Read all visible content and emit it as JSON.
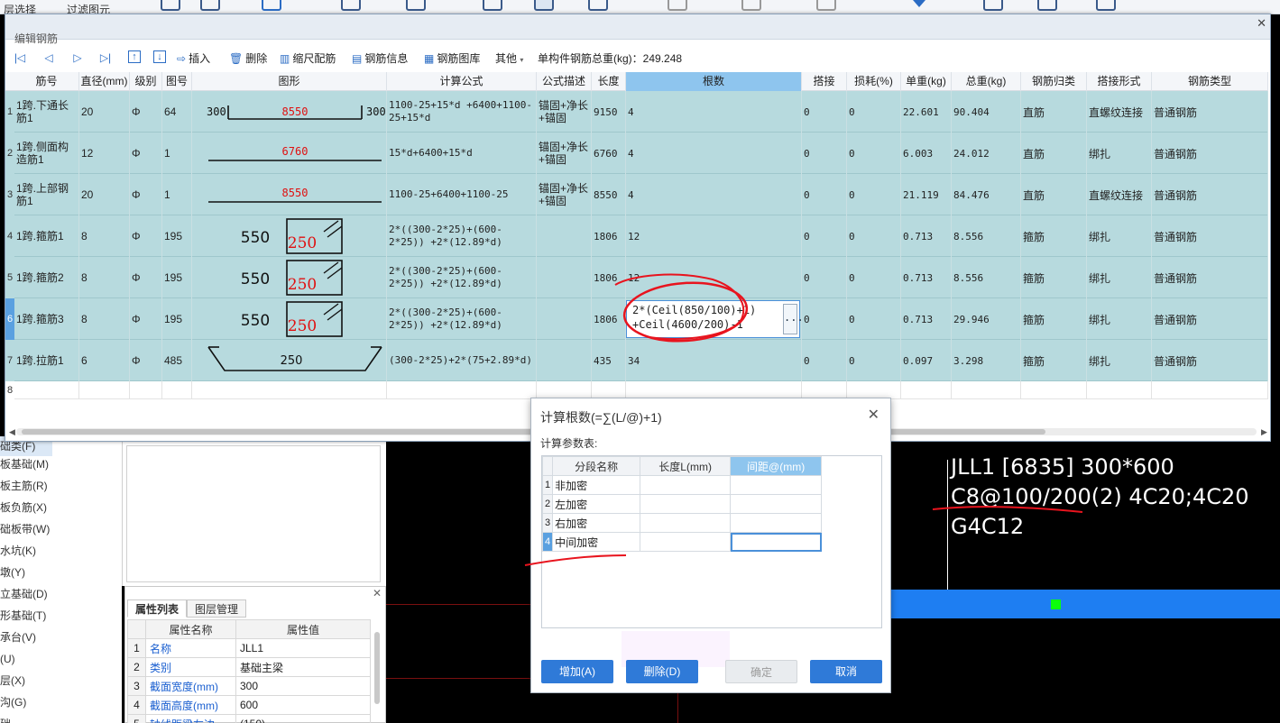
{
  "app_toolbar": {
    "left_text": "层选择",
    "filter_text": "过滤图元"
  },
  "left_tree": {
    "items": [
      "础类(F)",
      "板基础(M)",
      "板主筋(R)",
      "板负筋(X)",
      "础板带(W)",
      "水坑(K)",
      "墩(Y)",
      "立基础(D)",
      "形基础(T)",
      "承台(V)",
      "(U)",
      "层(X)",
      "沟(G)",
      "础"
    ]
  },
  "property_panel": {
    "close": "✕",
    "tabs": [
      "属性列表",
      "图层管理"
    ],
    "headers": [
      "属性名称",
      "属性值"
    ],
    "rows": [
      {
        "idx": "1",
        "name": "名称",
        "value": "JLL1"
      },
      {
        "idx": "2",
        "name": "类别",
        "value": "基础主梁"
      },
      {
        "idx": "3",
        "name": "截面宽度(mm)",
        "value": "300"
      },
      {
        "idx": "4",
        "name": "截面高度(mm)",
        "value": "600"
      },
      {
        "idx": "5",
        "name": "轴线距梁左边",
        "value": "(150)"
      }
    ]
  },
  "cad": {
    "label_line1": "JLL1 [6835] 300*600",
    "label_line2": "C8@100/200(2) 4C20;4C20",
    "label_line3": "G4C12",
    "colors": {
      "beam": "#1e7ef2",
      "node": "#0cff0c",
      "grid": "#7a1010"
    }
  },
  "edit_window": {
    "title": "编辑钢筋",
    "close": "✕",
    "toolbar": {
      "insert": "插入",
      "delete": "删除",
      "scale_rebar": "缩尺配筋",
      "rebar_info": "钢筋信息",
      "rebar_library": "钢筋图库",
      "other": "其他",
      "total_weight_label": "单构件钢筋总重(kg)：249.248"
    },
    "columns": [
      "筋号",
      "直径(mm)",
      "级别",
      "图号",
      "图形",
      "计算公式",
      "公式描述",
      "长度",
      "根数",
      "搭接",
      "损耗(%)",
      "单重(kg)",
      "总重(kg)",
      "钢筋归类",
      "搭接形式",
      "钢筋类型"
    ],
    "rows": [
      {
        "num": "1",
        "name": "1跨.下通长筋1",
        "dia": "20",
        "grade": "Φ",
        "fig": "64",
        "shape": {
          "type": "straight_hooks",
          "main": "8550",
          "left": "300",
          "right": "300"
        },
        "formula": "1100-25+15*d +6400+1100-25+15*d",
        "desc": "锚固+净长+锚固",
        "length": "9150",
        "count": "4",
        "lap": "0",
        "loss": "0",
        "unit_w": "22.601",
        "total_w": "90.404",
        "category": "直筋",
        "lap_type": "直螺纹连接",
        "rebar_type": "普通钢筋"
      },
      {
        "num": "2",
        "name": "1跨.侧面构造筋1",
        "dia": "12",
        "grade": "Φ",
        "fig": "1",
        "shape": {
          "type": "straight",
          "main": "6760"
        },
        "formula": "15*d+6400+15*d",
        "desc": "锚固+净长+锚固",
        "length": "6760",
        "count": "4",
        "lap": "0",
        "loss": "0",
        "unit_w": "6.003",
        "total_w": "24.012",
        "category": "直筋",
        "lap_type": "绑扎",
        "rebar_type": "普通钢筋"
      },
      {
        "num": "3",
        "name": "1跨.上部钢筋1",
        "dia": "20",
        "grade": "Φ",
        "fig": "1",
        "shape": {
          "type": "straight",
          "main": "8550"
        },
        "formula": "1100-25+6400+1100-25",
        "desc": "锚固+净长+锚固",
        "length": "8550",
        "count": "4",
        "lap": "0",
        "loss": "0",
        "unit_w": "21.119",
        "total_w": "84.476",
        "category": "直筋",
        "lap_type": "直螺纹连接",
        "rebar_type": "普通钢筋"
      },
      {
        "num": "4",
        "name": "1跨.箍筋1",
        "dia": "8",
        "grade": "Φ",
        "fig": "195",
        "shape": {
          "type": "stirrup",
          "h": "550",
          "w": "250"
        },
        "formula": "2*((300-2*25)+(600-2*25)) +2*(12.89*d)",
        "desc": "",
        "length": "1806",
        "count": "12",
        "lap": "0",
        "loss": "0",
        "unit_w": "0.713",
        "total_w": "8.556",
        "category": "箍筋",
        "lap_type": "绑扎",
        "rebar_type": "普通钢筋"
      },
      {
        "num": "5",
        "name": "1跨.箍筋2",
        "dia": "8",
        "grade": "Φ",
        "fig": "195",
        "shape": {
          "type": "stirrup",
          "h": "550",
          "w": "250"
        },
        "formula": "2*((300-2*25)+(600-2*25)) +2*(12.89*d)",
        "desc": "",
        "length": "1806",
        "count": "12",
        "lap": "0",
        "loss": "0",
        "unit_w": "0.713",
        "total_w": "8.556",
        "category": "箍筋",
        "lap_type": "绑扎",
        "rebar_type": "普通钢筋"
      },
      {
        "num": "6",
        "name": "1跨.箍筋3",
        "dia": "8",
        "grade": "Φ",
        "fig": "195",
        "shape": {
          "type": "stirrup",
          "h": "550",
          "w": "250"
        },
        "formula": "2*((300-2*25)+(600-2*25)) +2*(12.89*d)",
        "desc": "",
        "length": "1806",
        "count": "2*(Ceil(850/100)+1)\n+Ceil(4600/200)-1",
        "lap": "0",
        "loss": "0",
        "unit_w": "0.713",
        "total_w": "29.946",
        "category": "箍筋",
        "lap_type": "绑扎",
        "rebar_type": "普通钢筋",
        "editing": true
      },
      {
        "num": "7",
        "name": "1跨.拉筋1",
        "dia": "6",
        "grade": "Φ",
        "fig": "485",
        "shape": {
          "type": "tie",
          "main": "250"
        },
        "formula": "(300-2*25)+2*(75+2.89*d)",
        "desc": "",
        "length": "435",
        "count": "34",
        "lap": "0",
        "loss": "0",
        "unit_w": "0.097",
        "total_w": "3.298",
        "category": "箍筋",
        "lap_type": "绑扎",
        "rebar_type": "普通钢筋"
      },
      {
        "num": "8"
      }
    ],
    "editor_more": "..."
  },
  "dialog": {
    "title": "计算根数(=∑(L/@)+1)",
    "close": "✕",
    "subtitle": "计算参数表:",
    "headers": [
      "分段名称",
      "长度L(mm)",
      "间距@(mm)"
    ],
    "rows": [
      {
        "num": "1",
        "name": "非加密",
        "length": "",
        "spacing": ""
      },
      {
        "num": "2",
        "name": "左加密",
        "length": "",
        "spacing": ""
      },
      {
        "num": "3",
        "name": "右加密",
        "length": "",
        "spacing": ""
      },
      {
        "num": "4",
        "name": "中间加密",
        "length": "",
        "spacing": ""
      }
    ],
    "buttons": {
      "add": "增加(A)",
      "delete": "删除(D)",
      "ok": "确定",
      "cancel": "取消"
    }
  }
}
